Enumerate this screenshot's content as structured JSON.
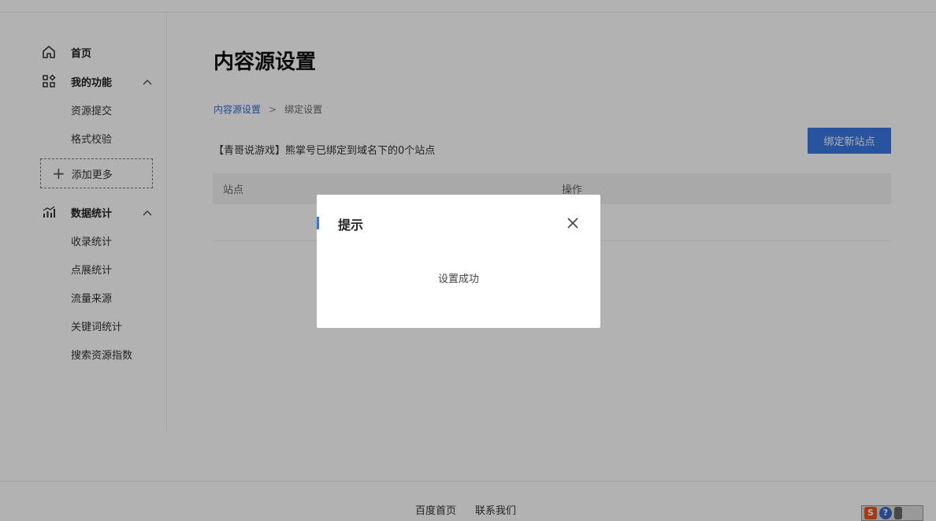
{
  "sidebar": {
    "home_label": "首页",
    "my_features": {
      "label": "我的功能",
      "items": [
        "资源提交",
        "格式校验"
      ]
    },
    "add_more_label": "添加更多",
    "data_stats": {
      "label": "数据统计",
      "items": [
        "收录统计",
        "点展统计",
        "流量来源",
        "关键词统计",
        "搜索资源指数"
      ]
    }
  },
  "main": {
    "title": "内容源设置",
    "breadcrumb": {
      "link": "内容源设置",
      "separator": ">",
      "current": "绑定设置"
    },
    "info_text": "【青哥说游戏】熊掌号已绑定到域名下的0个站点",
    "bind_button": "绑定新站点",
    "table": {
      "columns": [
        "站点",
        "操作"
      ]
    }
  },
  "footer": {
    "links": [
      "百度首页",
      "联系我们"
    ]
  },
  "modal": {
    "title": "提示",
    "message": "设置成功"
  },
  "colors": {
    "accent": "#3978e4",
    "link": "#2f6fd6",
    "overlay": "rgba(0,0,0,0.3)"
  }
}
